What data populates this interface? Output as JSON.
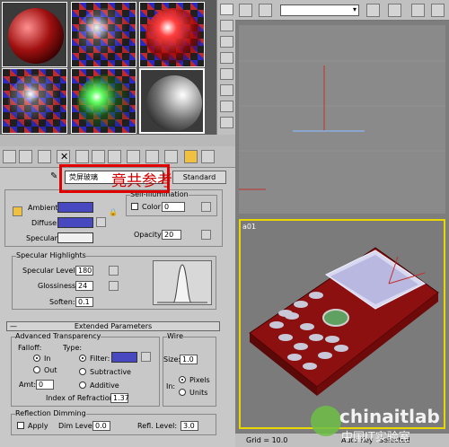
{
  "material_editor": {
    "name_value": "荧屏玻璃",
    "overlay_text": "竟共参考",
    "type_button": "Standard",
    "blinn_basic": {
      "ambient_label": "Ambient:",
      "diffuse_label": "Diffuse:",
      "specular_label": "Specular:",
      "self_illum_title": "Self-Illumination",
      "color_label": "Color",
      "color_value": "0",
      "opacity_label": "Opacity:",
      "opacity_value": "20",
      "ambient_color": "#4848c0",
      "diffuse_color": "#4848c0",
      "specular_color": "#f0f0f0"
    },
    "specular_highlights": {
      "title": "Specular Highlights",
      "level_label": "Specular Level:",
      "level_value": "180",
      "gloss_label": "Glossiness:",
      "gloss_value": "24",
      "soften_label": "Soften:",
      "soften_value": "0.1"
    },
    "extended": {
      "rollout_title": "Extended Parameters",
      "adv_title": "Advanced Transparency",
      "falloff_label": "Falloff:",
      "type_label": "Type:",
      "in_label": "In",
      "out_label": "Out",
      "amt_label": "Amt:",
      "amt_value": "0",
      "filter_label": "Filter:",
      "filter_color": "#4848c0",
      "subtractive_label": "Subtractive",
      "additive_label": "Additive",
      "ior_label": "Index of Refraction:",
      "ior_value": "1.37",
      "wire_title": "Wire",
      "size_label": "Size:",
      "size_value": "1.0",
      "in_units_label": "In:",
      "pixels_label": "Pixels",
      "units_label": "Units",
      "refl_title": "Reflection Dimming",
      "apply_label": "Apply",
      "dim_label": "Dim Level:",
      "dim_value": "0.0",
      "refl_level_label": "Refl. Level:",
      "refl_level_value": "3.0"
    }
  },
  "viewport": {
    "bottom_label": "a01",
    "grid_text": "Grid = 10.0",
    "autokey_text": "Auto Key",
    "selected_text": "Selected"
  },
  "watermark": {
    "brand": "chinaitlab",
    "cn": "中国IT实验室"
  }
}
